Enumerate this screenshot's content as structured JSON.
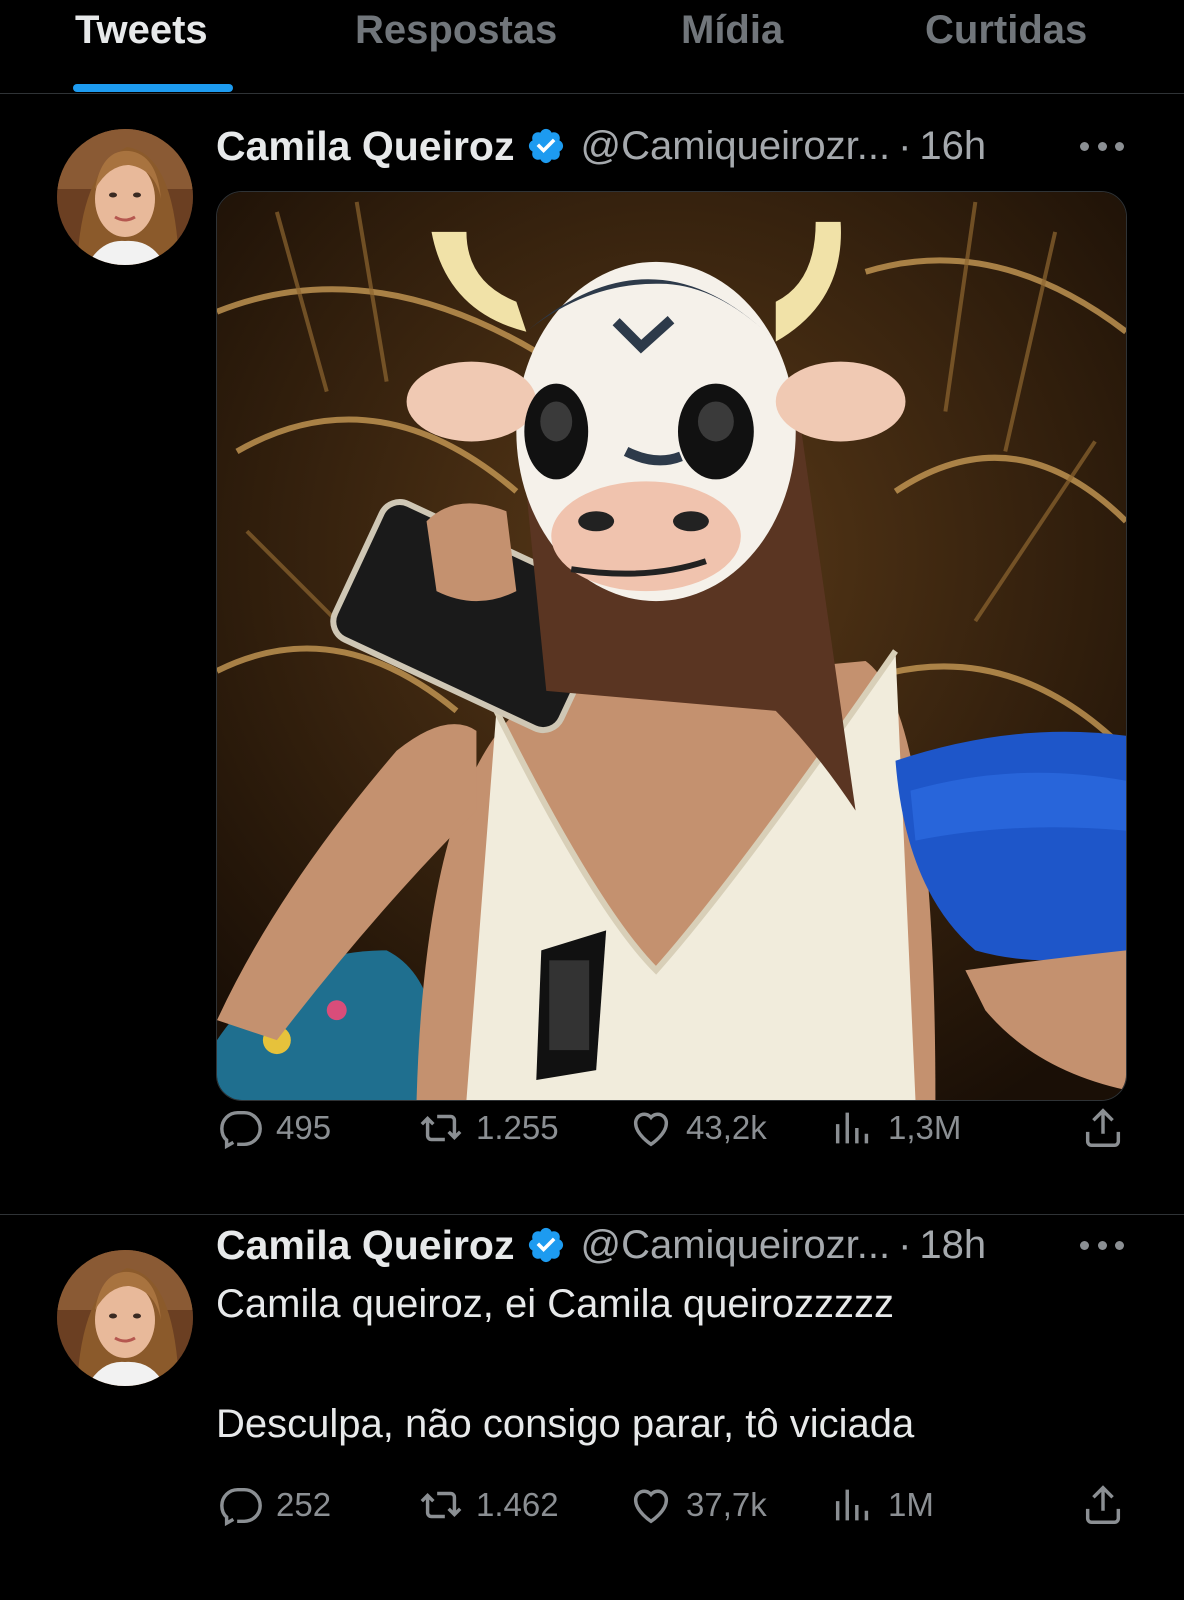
{
  "tabs": [
    {
      "label": "Tweets",
      "active": true
    },
    {
      "label": "Respostas",
      "active": false
    },
    {
      "label": "Mídia",
      "active": false
    },
    {
      "label": "Curtidas",
      "active": false
    }
  ],
  "colors": {
    "accent": "#1d9bf0",
    "background": "#000000",
    "muted": "#71767b"
  },
  "tweets": [
    {
      "name": "Camila Queiroz",
      "handle": "@Camiqueirozr...",
      "separator": "·",
      "time": "16h",
      "verified": true,
      "media": "photo-woman-cow-mask",
      "stats": {
        "replies": "495",
        "retweets": "1.255",
        "likes": "43,2k",
        "views": "1,3M"
      }
    },
    {
      "name": "Camila Queiroz",
      "handle": "@Camiqueirozr...",
      "separator": "·",
      "time": "18h",
      "verified": true,
      "text": "Camila queiroz, ei Camila queirozzzzz\n\nDesculpa, não consigo parar, tô viciada",
      "stats": {
        "replies": "252",
        "retweets": "1.462",
        "likes": "37,7k",
        "views": "1M"
      }
    }
  ],
  "icons": [
    "reply-icon",
    "retweet-icon",
    "like-icon",
    "views-icon",
    "share-icon",
    "verified-badge-icon",
    "more-icon"
  ]
}
